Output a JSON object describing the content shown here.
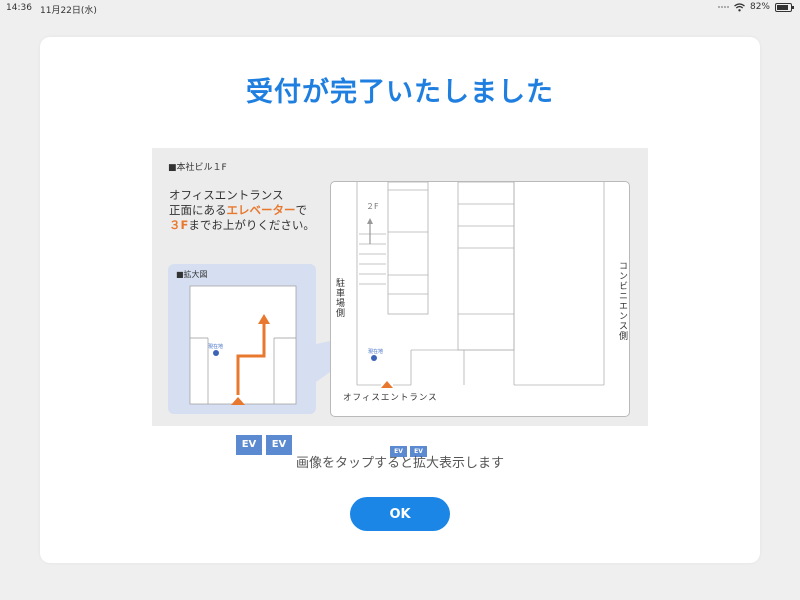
{
  "status_bar": {
    "time": "14:36",
    "date": "11月22日(水)",
    "battery": "82%",
    "icons": [
      "signal-dots-icon",
      "wifi-icon",
      "battery-icon"
    ]
  },
  "dialog": {
    "title": "受付が完了いたしました",
    "map": {
      "building_label": "■本社ビル１F",
      "directions_line1": "オフィスエントランス",
      "directions_line2_prefix": "正面にある",
      "directions_line2_highlight": "エレベーター",
      "directions_line2_suffix": "で",
      "directions_line3_highlight": "３F",
      "directions_line3_suffix": "までお上がりください。",
      "inset_label": "■拡大図",
      "elevator_label": "EV",
      "current_location_label": "現在地",
      "floor_label": "２F",
      "parking_side": "駐車場側",
      "convenience_side": "コンビニエンス側",
      "office_entrance": "オフィスエントランス"
    },
    "hint": "画像をタップすると拡大表示します",
    "ok_label": "OK"
  },
  "colors": {
    "title": "#1f7fe0",
    "ok_button": "#1c86e6",
    "highlight": "#e8782e",
    "elevator": "#5b8ad0",
    "inset_bg": "#d5dff1"
  }
}
